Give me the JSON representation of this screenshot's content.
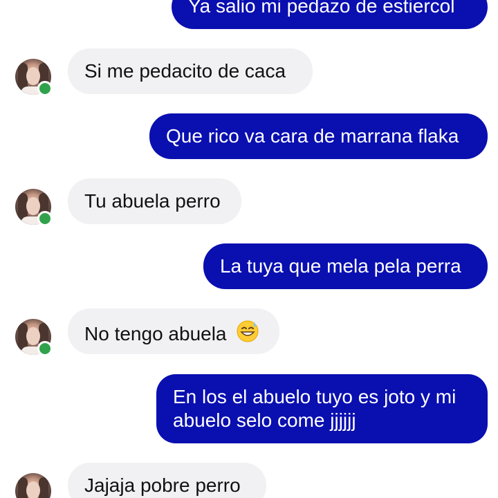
{
  "messages": [
    {
      "direction": "sent",
      "text": "Ya salio mi pedazo de estiercol"
    },
    {
      "direction": "received",
      "text": "Si me pedacito de caca"
    },
    {
      "direction": "sent",
      "text": "Que rico va cara de marrana flaka"
    },
    {
      "direction": "received",
      "text": "Tu abuela perro"
    },
    {
      "direction": "sent",
      "text": "La tuya que mela pela perra"
    },
    {
      "direction": "received",
      "text": "No tengo abuela",
      "emoji": "grinning-sweat-emoji"
    },
    {
      "direction": "sent",
      "line1": "En los el abuelo tuyo es joto y mi",
      "line2": "abuelo selo come jjjjjj"
    },
    {
      "direction": "received",
      "text": "Jajaja pobre perro"
    }
  ],
  "contact": {
    "status": "online",
    "status_color": "#31a24c"
  },
  "colors": {
    "sent_bubble": "#0a0fb0",
    "received_bubble": "#f1f0f3"
  }
}
